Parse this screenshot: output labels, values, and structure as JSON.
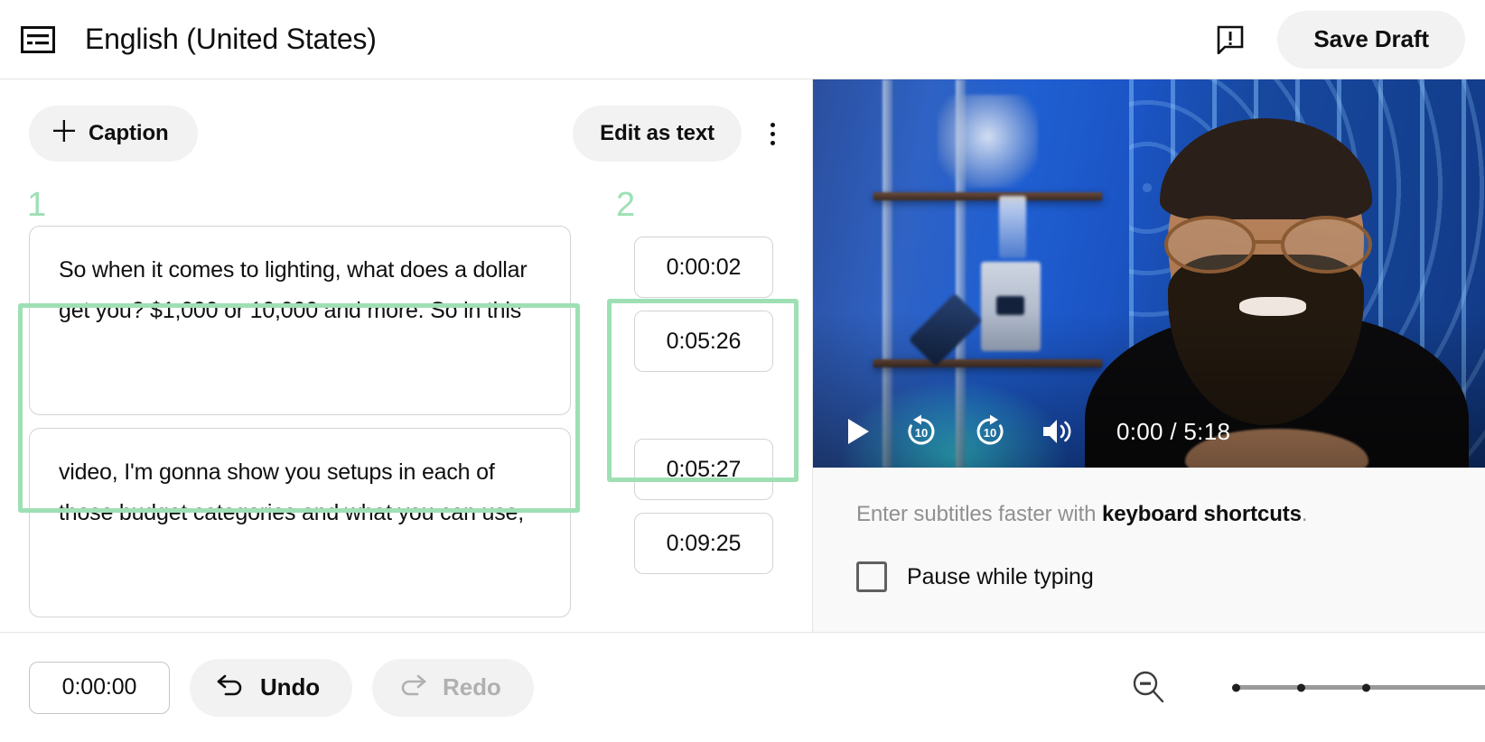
{
  "header": {
    "cc_icon": "closed-caption-icon",
    "title": "English (United States)",
    "feedback_icon": "feedback-exclamation-icon",
    "save_draft_label": "Save Draft"
  },
  "editor": {
    "add_caption_label": "Caption",
    "add_caption_icon": "plus-icon",
    "edit_as_text_label": "Edit as text",
    "more_options_icon": "kebab-menu-icon",
    "annotations": [
      {
        "number": "1",
        "target": "caption-text-box"
      },
      {
        "number": "2",
        "target": "caption-time-stack"
      }
    ],
    "rows": [
      {
        "text": "So when it comes to lighting, what does a dollar\nget you? $1,000 or 10,000 and more. So in this",
        "start_time": "0:00:02",
        "end_time": "0:05:26",
        "highlighted": true
      },
      {
        "text": "video, I'm gonna show you setups in each of\nthose budget categories and what you can use,",
        "start_time": "0:05:27",
        "end_time": "0:09:25",
        "highlighted": false
      }
    ]
  },
  "preview": {
    "player": {
      "play_icon": "play-icon",
      "rewind_icon": "replay-10-icon",
      "forward_icon": "forward-10-icon",
      "volume_icon": "volume-on-icon",
      "current_time": "0:00",
      "duration": "5:18",
      "time_separator": "/",
      "rewind_seconds": "10",
      "forward_seconds": "10"
    },
    "hint_prefix": "Enter subtitles faster with ",
    "hint_link": "keyboard shortcuts",
    "hint_suffix": ".",
    "pause_while_typing_label": "Pause while typing",
    "pause_while_typing_checked": false
  },
  "bottom_bar": {
    "time_value": "0:00:00",
    "undo_label": "Undo",
    "undo_icon": "undo-arrow-icon",
    "redo_label": "Redo",
    "redo_icon": "redo-arrow-icon",
    "redo_disabled": true,
    "zoom_out_icon": "zoom-out-icon"
  },
  "colors": {
    "annotation_green": "#9ee0b4",
    "button_gray": "#f2f2f2",
    "panel_gray": "#f9f9f9",
    "text_primary": "#0f0f0f",
    "text_muted": "#909090"
  }
}
